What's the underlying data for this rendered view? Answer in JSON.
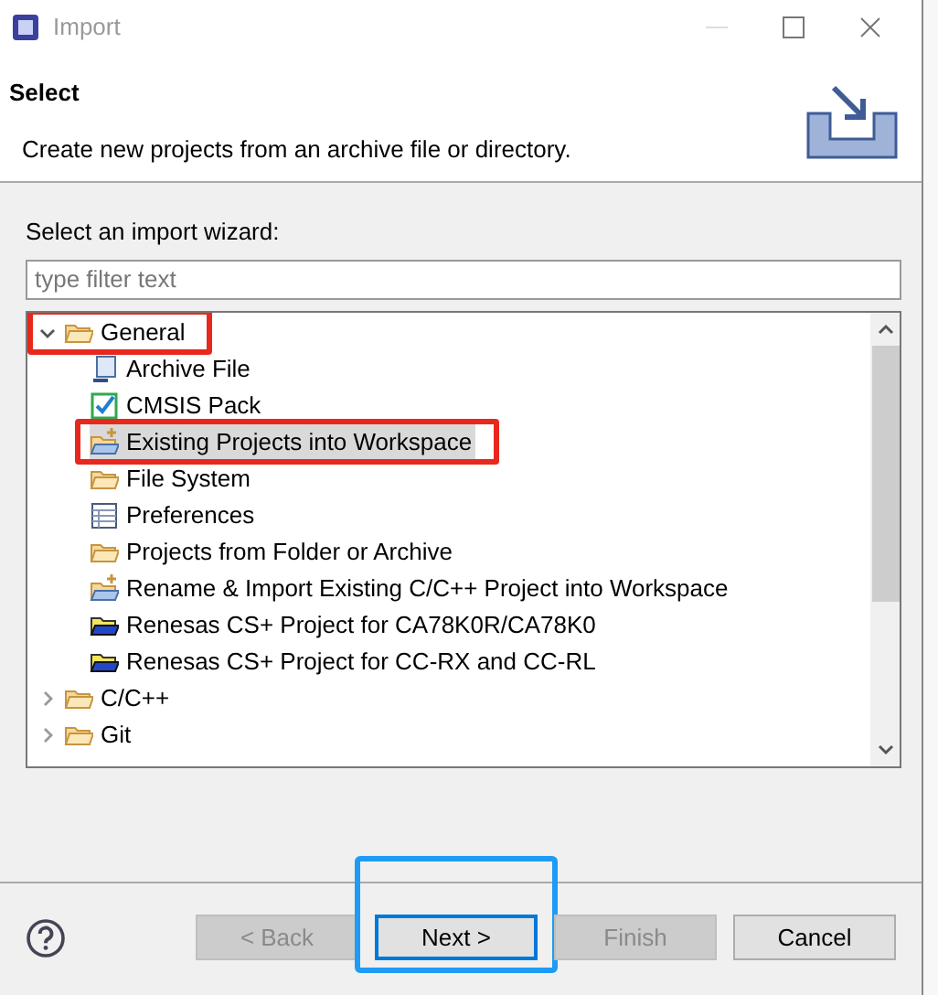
{
  "window": {
    "title": "Import"
  },
  "header": {
    "title": "Select",
    "description": "Create new projects from an archive file or directory."
  },
  "wizard_label": "Select an import wizard:",
  "filter": {
    "placeholder": "type filter text"
  },
  "tree": [
    {
      "label": "General",
      "kind": "folder",
      "expanded": true,
      "selected": false,
      "highlighted": true,
      "children": [
        {
          "label": "Archive File",
          "kind": "archive",
          "selected": false,
          "highlighted": false
        },
        {
          "label": "CMSIS Pack",
          "kind": "check",
          "selected": false,
          "highlighted": false
        },
        {
          "label": "Existing Projects into Workspace",
          "kind": "import",
          "selected": true,
          "highlighted": true
        },
        {
          "label": "File System",
          "kind": "folder",
          "selected": false,
          "highlighted": false
        },
        {
          "label": "Preferences",
          "kind": "table",
          "selected": false,
          "highlighted": false
        },
        {
          "label": "Projects from Folder or Archive",
          "kind": "folder",
          "selected": false,
          "highlighted": false
        },
        {
          "label": "Rename & Import Existing C/C++ Project into Workspace",
          "kind": "import",
          "selected": false,
          "highlighted": false
        },
        {
          "label": "Renesas CS+ Project for CA78K0R/CA78K0",
          "kind": "renesas",
          "selected": false,
          "highlighted": false
        },
        {
          "label": "Renesas CS+ Project for CC-RX and CC-RL",
          "kind": "renesas",
          "selected": false,
          "highlighted": false
        }
      ]
    },
    {
      "label": "C/C++",
      "kind": "folder",
      "expanded": false,
      "selected": false,
      "highlighted": false
    },
    {
      "label": "Git",
      "kind": "folder",
      "expanded": false,
      "selected": false,
      "highlighted": false
    }
  ],
  "buttons": [
    {
      "label": "< Back",
      "disabled": true,
      "default": false,
      "highlighted": false
    },
    {
      "label": "Next >",
      "disabled": false,
      "default": true,
      "highlighted": true
    },
    {
      "label": "Finish",
      "disabled": true,
      "default": false,
      "highlighted": false
    },
    {
      "label": "Cancel",
      "disabled": false,
      "default": false,
      "highlighted": false
    }
  ]
}
